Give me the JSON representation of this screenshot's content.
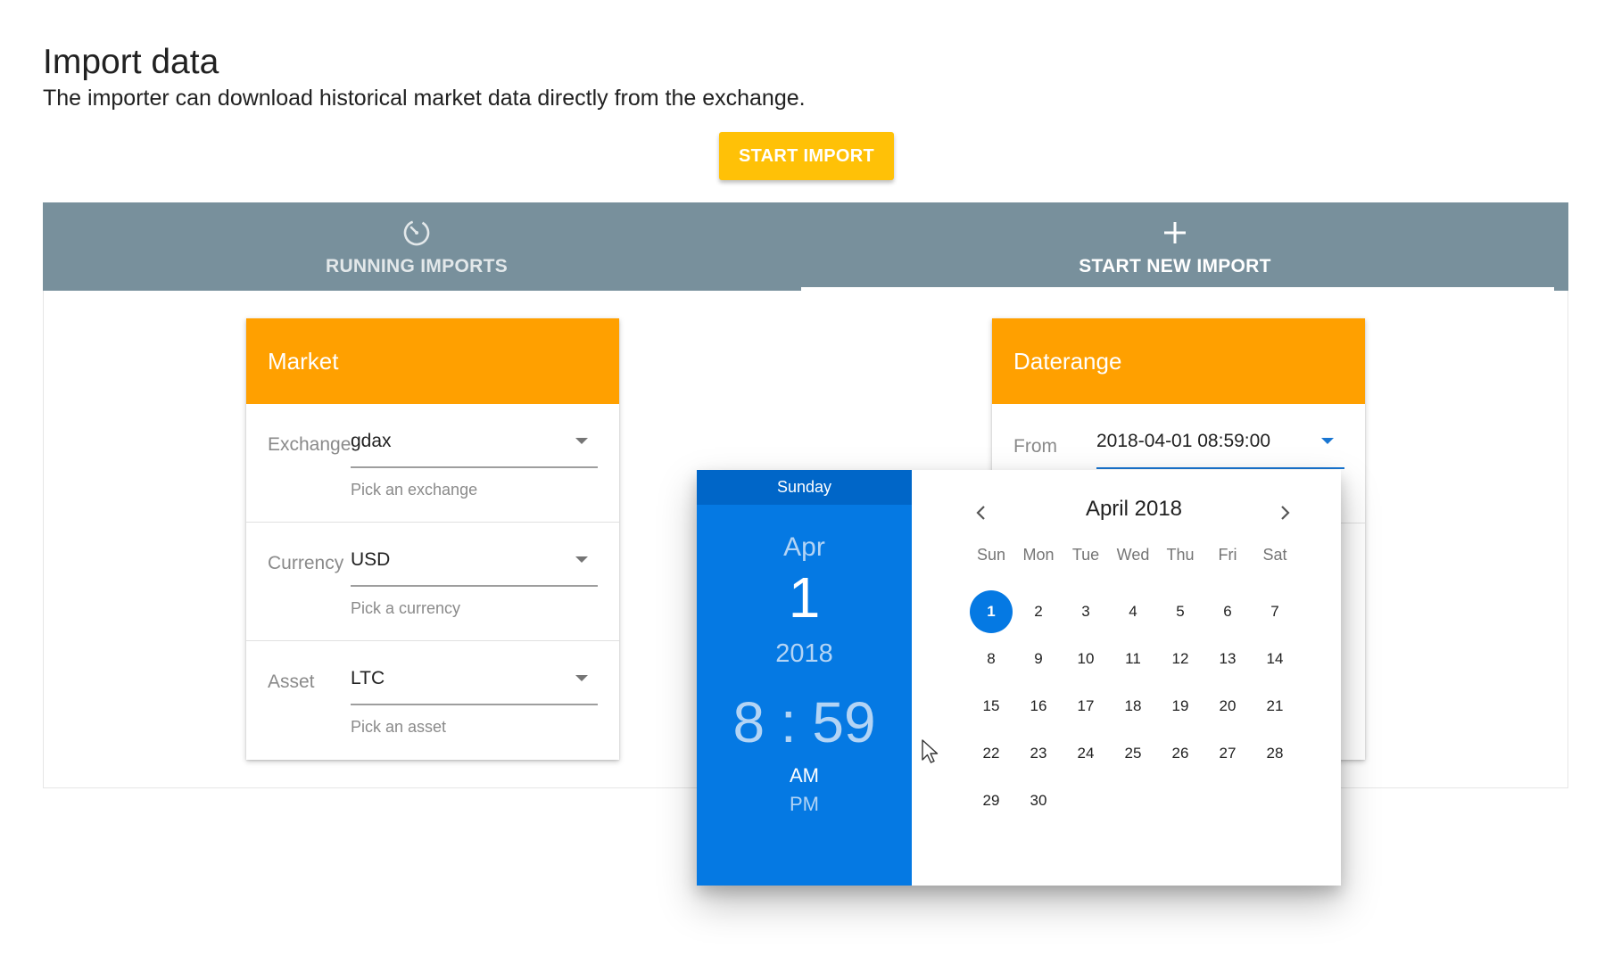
{
  "header": {
    "title": "Import data",
    "subtitle": "The importer can download historical market data directly from the exchange.",
    "start_button": "START IMPORT"
  },
  "tabs": [
    {
      "label": "RUNNING IMPORTS",
      "icon": "timer-icon",
      "active": false
    },
    {
      "label": "START NEW IMPORT",
      "icon": "plus-icon",
      "active": true
    }
  ],
  "market": {
    "title": "Market",
    "fields": [
      {
        "label": "Exchange",
        "value": "gdax",
        "hint": "Pick an exchange"
      },
      {
        "label": "Currency",
        "value": "USD",
        "hint": "Pick a currency"
      },
      {
        "label": "Asset",
        "value": "LTC",
        "hint": "Pick an asset"
      }
    ]
  },
  "daterange": {
    "title": "Daterange",
    "from_label": "From",
    "from_value": "2018-04-01 08:59:00"
  },
  "picker": {
    "weekday": "Sunday",
    "month": "Apr",
    "day": "1",
    "year": "2018",
    "time": "8 : 59",
    "am": "AM",
    "pm": "PM",
    "calendar_title": "April 2018",
    "weekdays": [
      "Sun",
      "Mon",
      "Tue",
      "Wed",
      "Thu",
      "Fri",
      "Sat"
    ],
    "first_weekday_index": 0,
    "days_in_month": 30,
    "selected_day": 1
  },
  "colors": {
    "accent": "#FFC107",
    "card_header": "#FFA000",
    "tab_bar": "#78909C",
    "picker_blue": "#0579E3",
    "picker_blue_dark": "#0066C8"
  }
}
